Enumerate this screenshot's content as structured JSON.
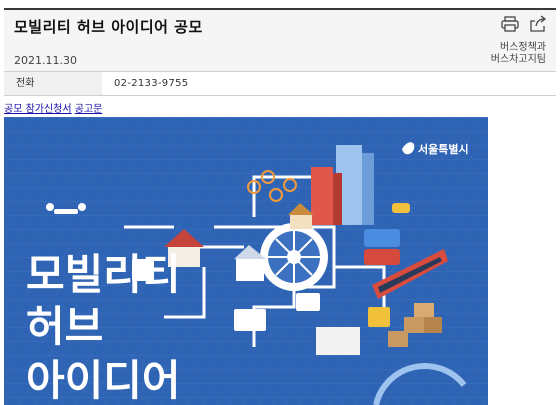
{
  "post": {
    "title": "모빌리티 허브 아이디어 공모",
    "date": "2021.11.30",
    "department_line1": "버스정책과",
    "department_line2": "버스차고지팀"
  },
  "info": {
    "phone_label": "전화",
    "phone_value": "02-2133-9755"
  },
  "attachments": [
    {
      "label": "공모 참가신청서"
    },
    {
      "label": "공고문"
    }
  ],
  "poster": {
    "headline_line1": "모빌리티",
    "headline_line2": "허브",
    "headline_line3": "아이디어",
    "org_logo_text": "서울특별시"
  },
  "icons": [
    "print-icon",
    "share-icon"
  ],
  "colors": {
    "poster_background": "#2f64b5",
    "header_background": "#f5f5f5",
    "link": "#1a0dab"
  }
}
